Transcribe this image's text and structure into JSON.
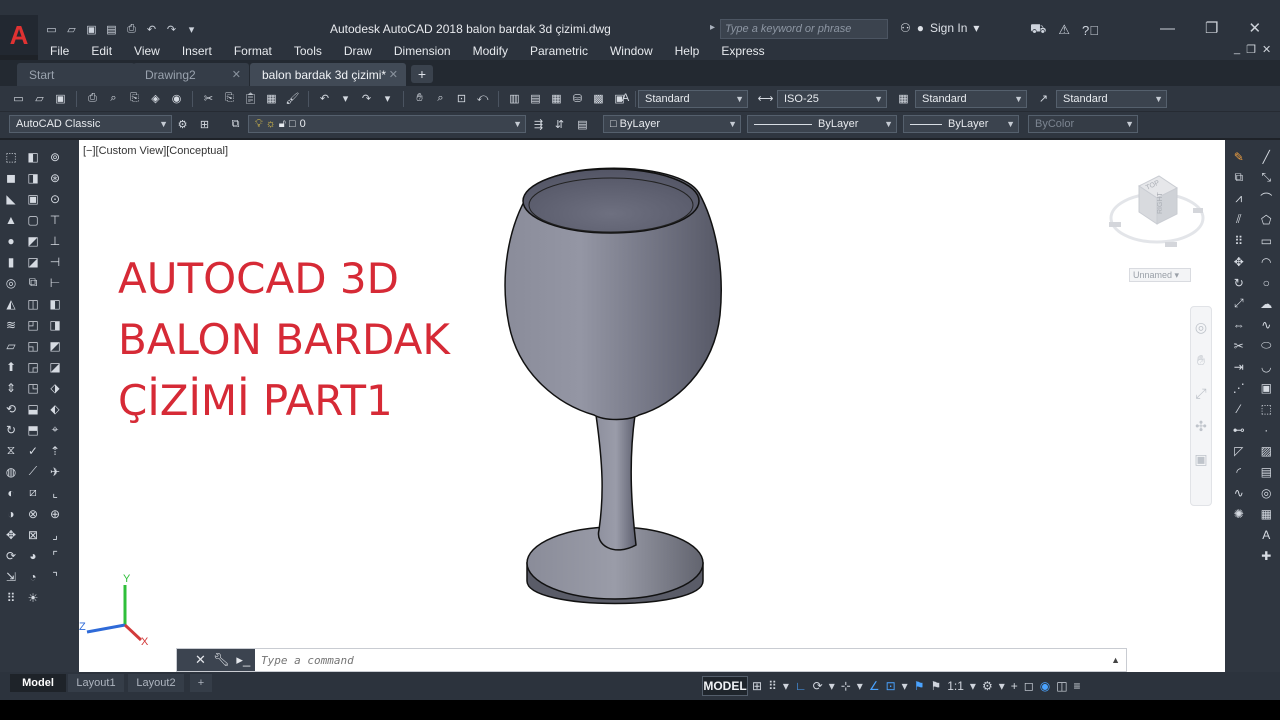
{
  "app": {
    "logo_letter": "A",
    "title": "Autodesk AutoCAD 2018    balon bardak 3d çizimi.dwg",
    "search_placeholder": "Type a keyword or phrase",
    "sign_in": "Sign In",
    "accent_color": "#d62a36"
  },
  "menu": [
    "File",
    "Edit",
    "View",
    "Insert",
    "Format",
    "Tools",
    "Draw",
    "Dimension",
    "Modify",
    "Parametric",
    "Window",
    "Help",
    "Express"
  ],
  "tabs": [
    {
      "label": "Start"
    },
    {
      "label": "Drawing2"
    },
    {
      "label": "balon bardak 3d çizimi*"
    }
  ],
  "styles_toolbar": {
    "text_style": "Standard",
    "dim_style": "ISO-25",
    "table_style": "Standard",
    "mleader_style": "Standard"
  },
  "properties_toolbar": {
    "workspace": "AutoCAD Classic",
    "layer": "0",
    "color": "ByLayer",
    "linetype": "ByLayer",
    "lineweight": "ByLayer",
    "plot_style": "ByColor"
  },
  "viewport": {
    "label": "[−][Custom View][Conceptual]",
    "overlay_line1": "AUTOCAD 3D",
    "overlay_line2": "BALON BARDAK",
    "overlay_line3": "ÇİZİMİ PART1",
    "viewcube_face": "RIGHT",
    "viewcube_top": "TOP",
    "ucs_name": "Unnamed",
    "axis_x": "X",
    "axis_y": "Y",
    "axis_z": "Z"
  },
  "command": {
    "placeholder": "Type a command"
  },
  "layout_tabs": [
    "Model",
    "Layout1",
    "Layout2"
  ],
  "status": {
    "model": "MODEL",
    "scale": "1:1"
  }
}
